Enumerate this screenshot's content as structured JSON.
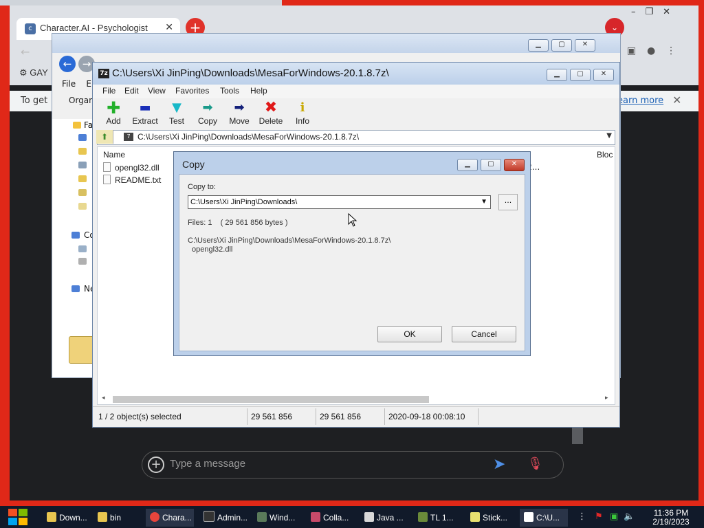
{
  "browser": {
    "tab_title": "Character.AI - Psychologist",
    "bookmark_label": "GAY",
    "infobar_text": "To get",
    "infobar_link": "earn more"
  },
  "explorer": {
    "menu_file": "File",
    "menu_edit": "E",
    "organize": "Organ",
    "side_labels": [
      "Fa",
      "Co",
      "Ne"
    ]
  },
  "zip": {
    "title": "C:\\Users\\Xi JinPing\\Downloads\\MesaForWindows-20.1.8.7z\\",
    "menu": [
      "File",
      "Edit",
      "View",
      "Favorites",
      "Tools",
      "Help"
    ],
    "toolbar": {
      "add": "Add",
      "extract": "Extract",
      "test": "Test",
      "copy": "Copy",
      "move": "Move",
      "delete": "Delete",
      "info": "Info"
    },
    "address": "C:\\Users\\Xi JinPing\\Downloads\\MesaForWindows-20.1.8.7z\\",
    "columns": {
      "name": "Name",
      "block": "Bloc"
    },
    "files": [
      "opengl32.dll",
      "README.txt"
    ],
    "partial_value": "A2...",
    "status": {
      "selected": "1 / 2 object(s) selected",
      "size": "29 561 856",
      "packed": "29 561 856",
      "modified": "2020-09-18 00:08:10"
    }
  },
  "copy_dialog": {
    "title": "Copy",
    "copy_to_label": "Copy to:",
    "path_value": "C:\\Users\\Xi JinPing\\Downloads\\",
    "browse_label": "...",
    "files_info": "Files: 1    ( 29 561 856 bytes )",
    "source_path": "C:\\Users\\Xi JinPing\\Downloads\\MesaForWindows-20.1.8.7z\\",
    "source_file": "opengl32.dll",
    "ok_label": "OK",
    "cancel_label": "Cancel"
  },
  "chat": {
    "placeholder": "Type a message"
  },
  "taskbar": {
    "items": [
      "Down...",
      "bin",
      "Chara...",
      "Admin...",
      "Wind...",
      "Colla...",
      "Java ...",
      "TL 1...",
      "Stick...",
      "C:\\U..."
    ],
    "time": "11:36 PM",
    "date": "2/19/2023"
  },
  "colors": {
    "background_red": "#e02818",
    "dialog_frame": "#bcd0ea",
    "taskbar": "#111a2a"
  }
}
